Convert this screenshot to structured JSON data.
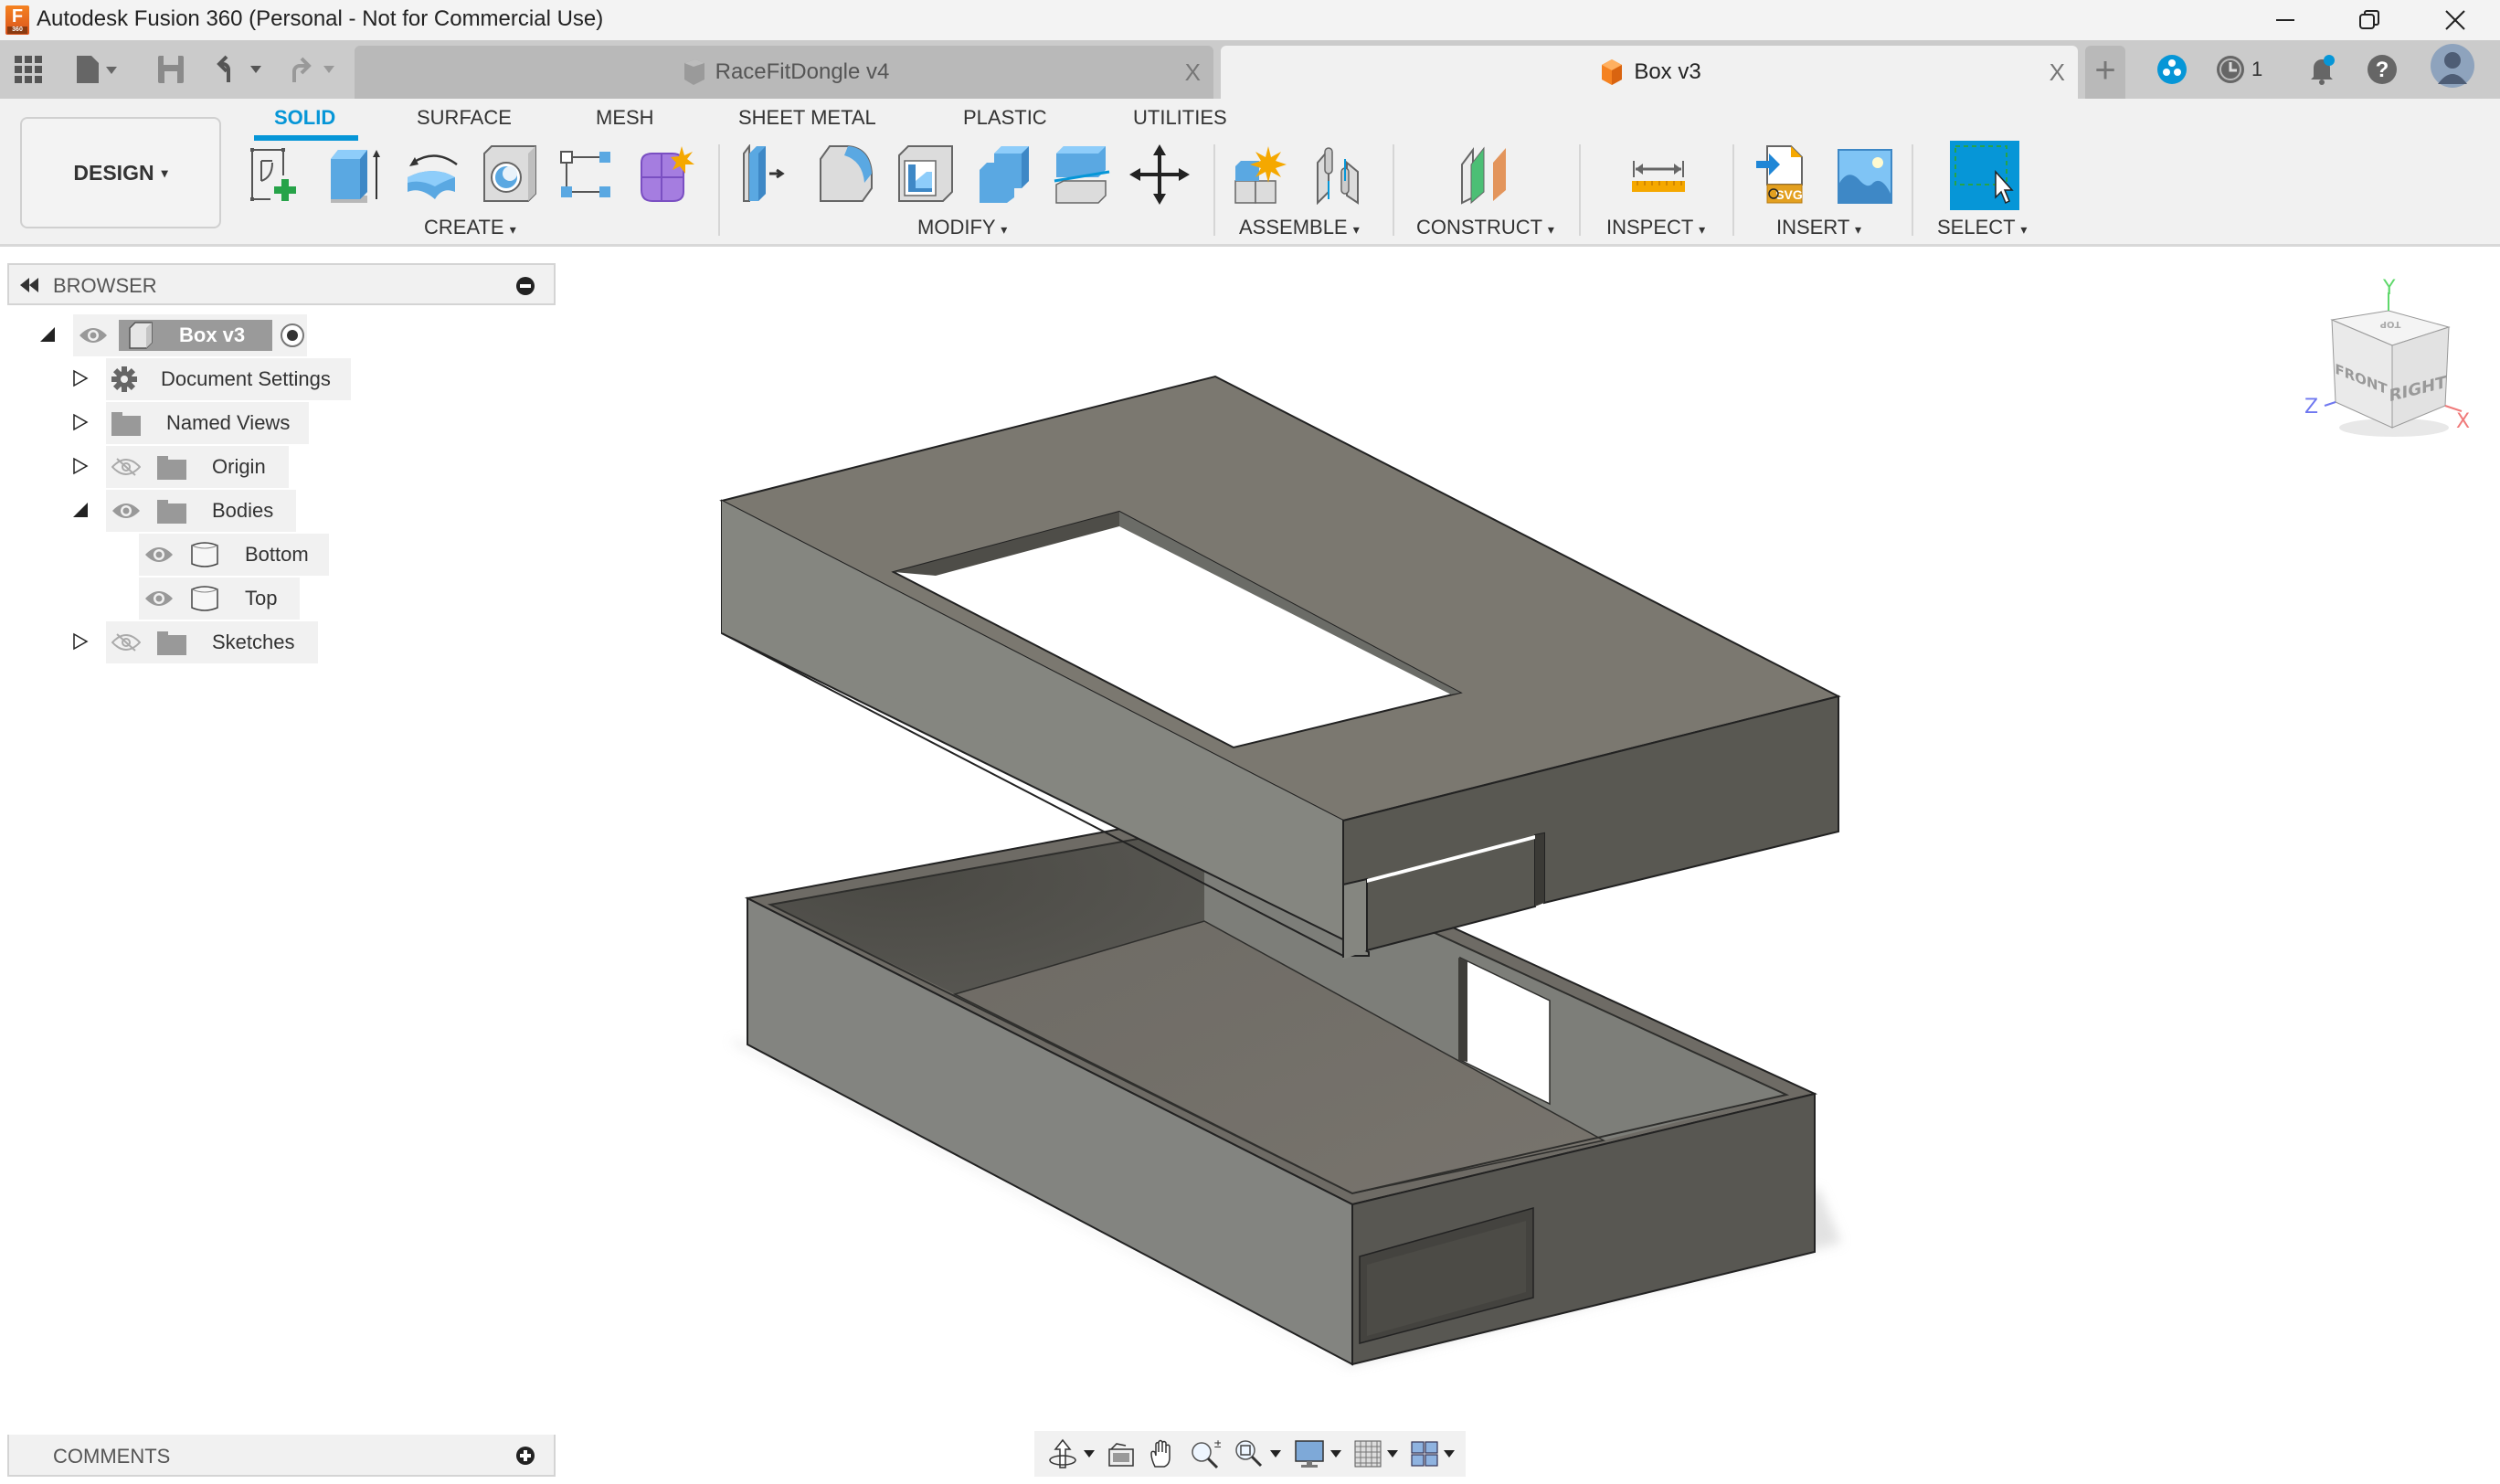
{
  "window": {
    "title": "Autodesk Fusion 360 (Personal - Not for Commercial Use)",
    "logo_letter": "F",
    "logo_sub": "360",
    "controls": [
      "minimize",
      "restore",
      "close"
    ]
  },
  "tabbar": {
    "quick_access": [
      "app-grid-icon",
      "file-icon",
      "save-icon",
      "undo-icon",
      "redo-icon"
    ],
    "tabs": [
      {
        "label": "RaceFitDongle v4",
        "active": false,
        "icon": "component-icon-gray"
      },
      {
        "label": "Box v3",
        "active": true,
        "icon": "component-icon-orange"
      }
    ],
    "close_glyph": "X",
    "new_tab_glyph": "+",
    "job_count": "1",
    "right_icons": [
      "extensions-icon",
      "job-status-icon",
      "notifications-icon",
      "help-icon",
      "user-avatar"
    ]
  },
  "ribbon": {
    "workspace": "DESIGN",
    "tabs": [
      {
        "label": "SOLID",
        "active": true
      },
      {
        "label": "SURFACE",
        "active": false
      },
      {
        "label": "MESH",
        "active": false
      },
      {
        "label": "SHEET METAL",
        "active": false
      },
      {
        "label": "PLASTIC",
        "active": false
      },
      {
        "label": "UTILITIES",
        "active": false
      }
    ],
    "groups": {
      "create": {
        "label": "CREATE",
        "tools": [
          "create-sketch",
          "extrude",
          "revolve",
          "hole",
          "pattern",
          "create-form"
        ]
      },
      "modify": {
        "label": "MODIFY",
        "tools": [
          "press-pull",
          "fillet",
          "shell",
          "combine",
          "split-body",
          "move-copy"
        ]
      },
      "assemble": {
        "label": "ASSEMBLE",
        "tools": [
          "new-component",
          "joint"
        ]
      },
      "construct": {
        "label": "CONSTRUCT",
        "tools": [
          "offset-plane"
        ]
      },
      "inspect": {
        "label": "INSPECT",
        "tools": [
          "measure"
        ]
      },
      "insert": {
        "label": "INSERT",
        "tools": [
          "insert-svg",
          "insert-canvas"
        ]
      },
      "select": {
        "label": "SELECT",
        "tools": [
          "select"
        ]
      }
    },
    "svg_badge": "SVG",
    "caret": "▾"
  },
  "browser": {
    "title": "BROWSER",
    "root": {
      "label": "Box v3"
    },
    "items": [
      {
        "label": "Document Settings",
        "icon": "gear",
        "expanded": false,
        "visible": null
      },
      {
        "label": "Named Views",
        "icon": "folder",
        "expanded": false,
        "visible": null
      },
      {
        "label": "Origin",
        "icon": "folder",
        "expanded": false,
        "visible": false
      },
      {
        "label": "Bodies",
        "icon": "folder",
        "expanded": true,
        "visible": true
      },
      {
        "label": "Bottom",
        "icon": "body",
        "visible": true
      },
      {
        "label": "Top",
        "icon": "body",
        "visible": true
      },
      {
        "label": "Sketches",
        "icon": "folder",
        "expanded": false,
        "visible": false
      }
    ]
  },
  "comments": {
    "title": "COMMENTS"
  },
  "viewcube": {
    "top": "TOP",
    "front": "FRONT",
    "right": "RIGHT",
    "axis_x": "X",
    "axis_y": "Y",
    "axis_z": "Z"
  },
  "navbar": {
    "tools": [
      "orbit",
      "look-at",
      "pan",
      "zoom",
      "fit",
      "display-settings",
      "grid-snaps",
      "viewports"
    ]
  },
  "colors": {
    "accent": "#0696d7",
    "body_top": "#7b7870",
    "body_left": "#858680",
    "body_right": "#595852"
  }
}
